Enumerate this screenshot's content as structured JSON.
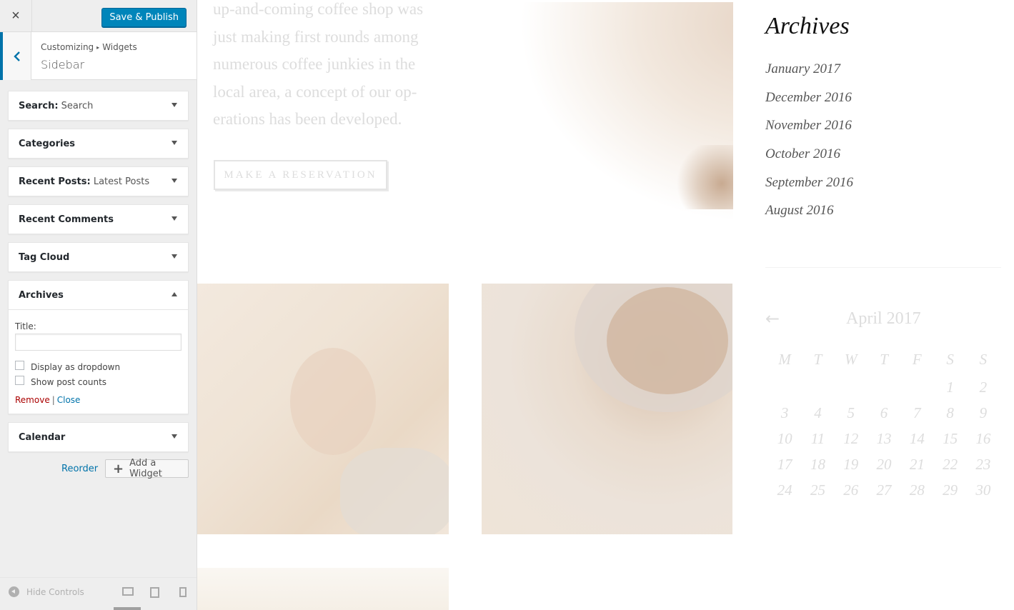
{
  "customizer": {
    "close_icon": "×",
    "save_label": "Save & Publish",
    "breadcrumb": {
      "root": "Customizing",
      "current": "Widgets"
    },
    "section_title": "Sidebar",
    "widgets": [
      {
        "title": "Search:",
        "subtitle": "Search",
        "expanded": false
      },
      {
        "title": "Categories",
        "subtitle": "",
        "expanded": false
      },
      {
        "title": "Recent Posts:",
        "subtitle": "Latest Posts",
        "expanded": false
      },
      {
        "title": "Recent Comments",
        "subtitle": "",
        "expanded": false
      },
      {
        "title": "Tag Cloud",
        "subtitle": "",
        "expanded": false
      },
      {
        "title": "Archives",
        "subtitle": "",
        "expanded": true
      },
      {
        "title": "Calendar",
        "subtitle": "",
        "expanded": false
      }
    ],
    "archives_form": {
      "title_label": "Title:",
      "title_value": "",
      "dropdown_label": "Display as dropdown",
      "dropdown_checked": false,
      "counts_label": "Show post counts",
      "counts_checked": false,
      "remove_label": "Remove",
      "close_label": "Close"
    },
    "reorder_label": "Reorder",
    "add_widget_label": "Add a Widget",
    "footer": {
      "hide_controls_label": "Hide Controls"
    },
    "accent_color": "#0073aa",
    "button_color": "#0085ba"
  },
  "preview": {
    "intro_text": "up-and-coming coffee shop was just making first rounds among numerous coffee junkies in the local area, a concept of our op-erations has been developed.",
    "reservation_button": "MAKE A RESERVATION",
    "archives": {
      "title": "Archives",
      "items": [
        "January 2017",
        "December 2016",
        "November 2016",
        "October 2016",
        "September 2016",
        "August 2016"
      ]
    },
    "calendar": {
      "prev_arrow": "←",
      "title": "April 2017",
      "weekdays": [
        "M",
        "T",
        "W",
        "T",
        "F",
        "S",
        "S"
      ],
      "weeks": [
        [
          "",
          "",
          "",
          "",
          "",
          "1",
          "2"
        ],
        [
          "3",
          "4",
          "5",
          "6",
          "7",
          "8",
          "9"
        ],
        [
          "10",
          "11",
          "12",
          "13",
          "14",
          "15",
          "16"
        ],
        [
          "17",
          "18",
          "19",
          "20",
          "21",
          "22",
          "23"
        ],
        [
          "24",
          "25",
          "26",
          "27",
          "28",
          "29",
          "30"
        ]
      ]
    }
  }
}
